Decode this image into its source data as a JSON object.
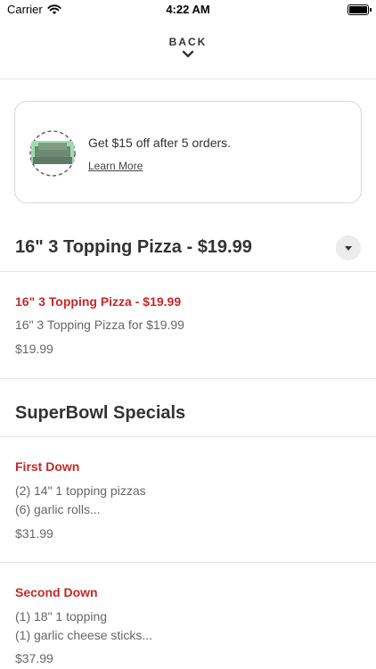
{
  "status": {
    "carrier": "Carrier",
    "time": "4:22 AM"
  },
  "nav": {
    "back_label": "BACK"
  },
  "promo": {
    "text": "Get $15 off after 5 orders.",
    "link": "Learn More"
  },
  "sections": [
    {
      "title": "16\" 3 Topping Pizza - $19.99",
      "items": [
        {
          "name": "16\" 3 Topping Pizza - $19.99",
          "description": [
            "16\" 3 Topping Pizza for $19.99"
          ],
          "price": "$19.99"
        }
      ]
    },
    {
      "title": "SuperBowl Specials",
      "items": [
        {
          "name": "First Down",
          "description": [
            "(2) 14\" 1 topping pizzas",
            "(6) garlic rolls..."
          ],
          "price": "$31.99"
        },
        {
          "name": "Second Down",
          "description": [
            "(1) 18\" 1 topping",
            "(1) garlic cheese sticks..."
          ],
          "price": "$37.99"
        }
      ]
    }
  ],
  "colors": {
    "accent_red": "#c62828",
    "promo_green": "#8fd6a0"
  }
}
